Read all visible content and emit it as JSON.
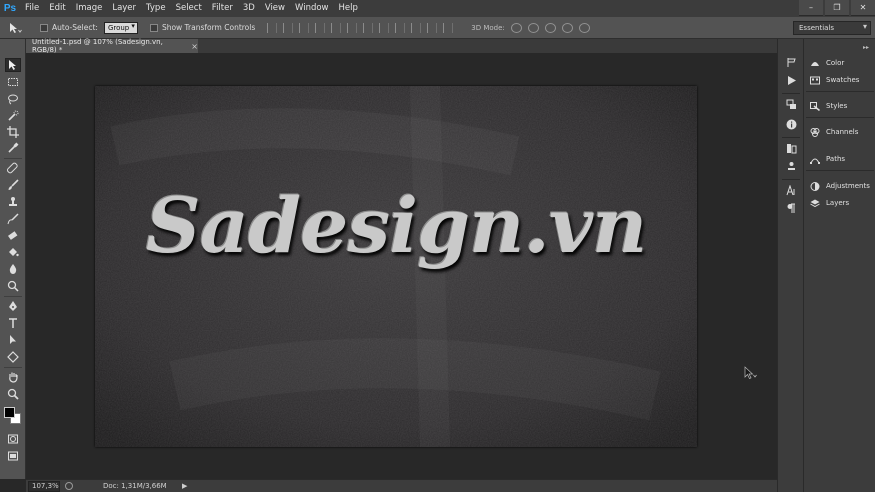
{
  "app": {
    "logo": "Ps"
  },
  "menu": [
    "File",
    "Edit",
    "Image",
    "Layer",
    "Type",
    "Select",
    "Filter",
    "3D",
    "View",
    "Window",
    "Help"
  ],
  "window_controls": {
    "minimize": "–",
    "restore": "❐",
    "close": "✕"
  },
  "options": {
    "auto_select_label": "Auto-Select:",
    "auto_select_value": "Group",
    "show_transform_label": "Show Transform Controls",
    "mode_3d_label": "3D Mode:"
  },
  "workspace": {
    "value": "Essentials"
  },
  "document": {
    "tab_title": "Untitled-1.psd @ 107% (Sadesign.vn, RGB/8) *",
    "close": "×",
    "canvas_text": "Sadesign.vn"
  },
  "status": {
    "zoom": "107,3%",
    "doc_info": "Doc: 1,31M/3,66M",
    "arrow": "▶"
  },
  "panels": [
    {
      "label": "Color",
      "icon": "color-icon"
    },
    {
      "label": "Swatches",
      "icon": "swatches-icon"
    },
    {
      "label": "Styles",
      "icon": "styles-icon"
    },
    {
      "label": "Channels",
      "icon": "channels-icon"
    },
    {
      "label": "Paths",
      "icon": "paths-icon"
    },
    {
      "label": "Adjustments",
      "icon": "adjustments-icon"
    },
    {
      "label": "Layers",
      "icon": "layers-icon"
    }
  ],
  "colors": {
    "foreground": "#000000",
    "background": "#ffffff",
    "accent": "#31a8ff"
  }
}
